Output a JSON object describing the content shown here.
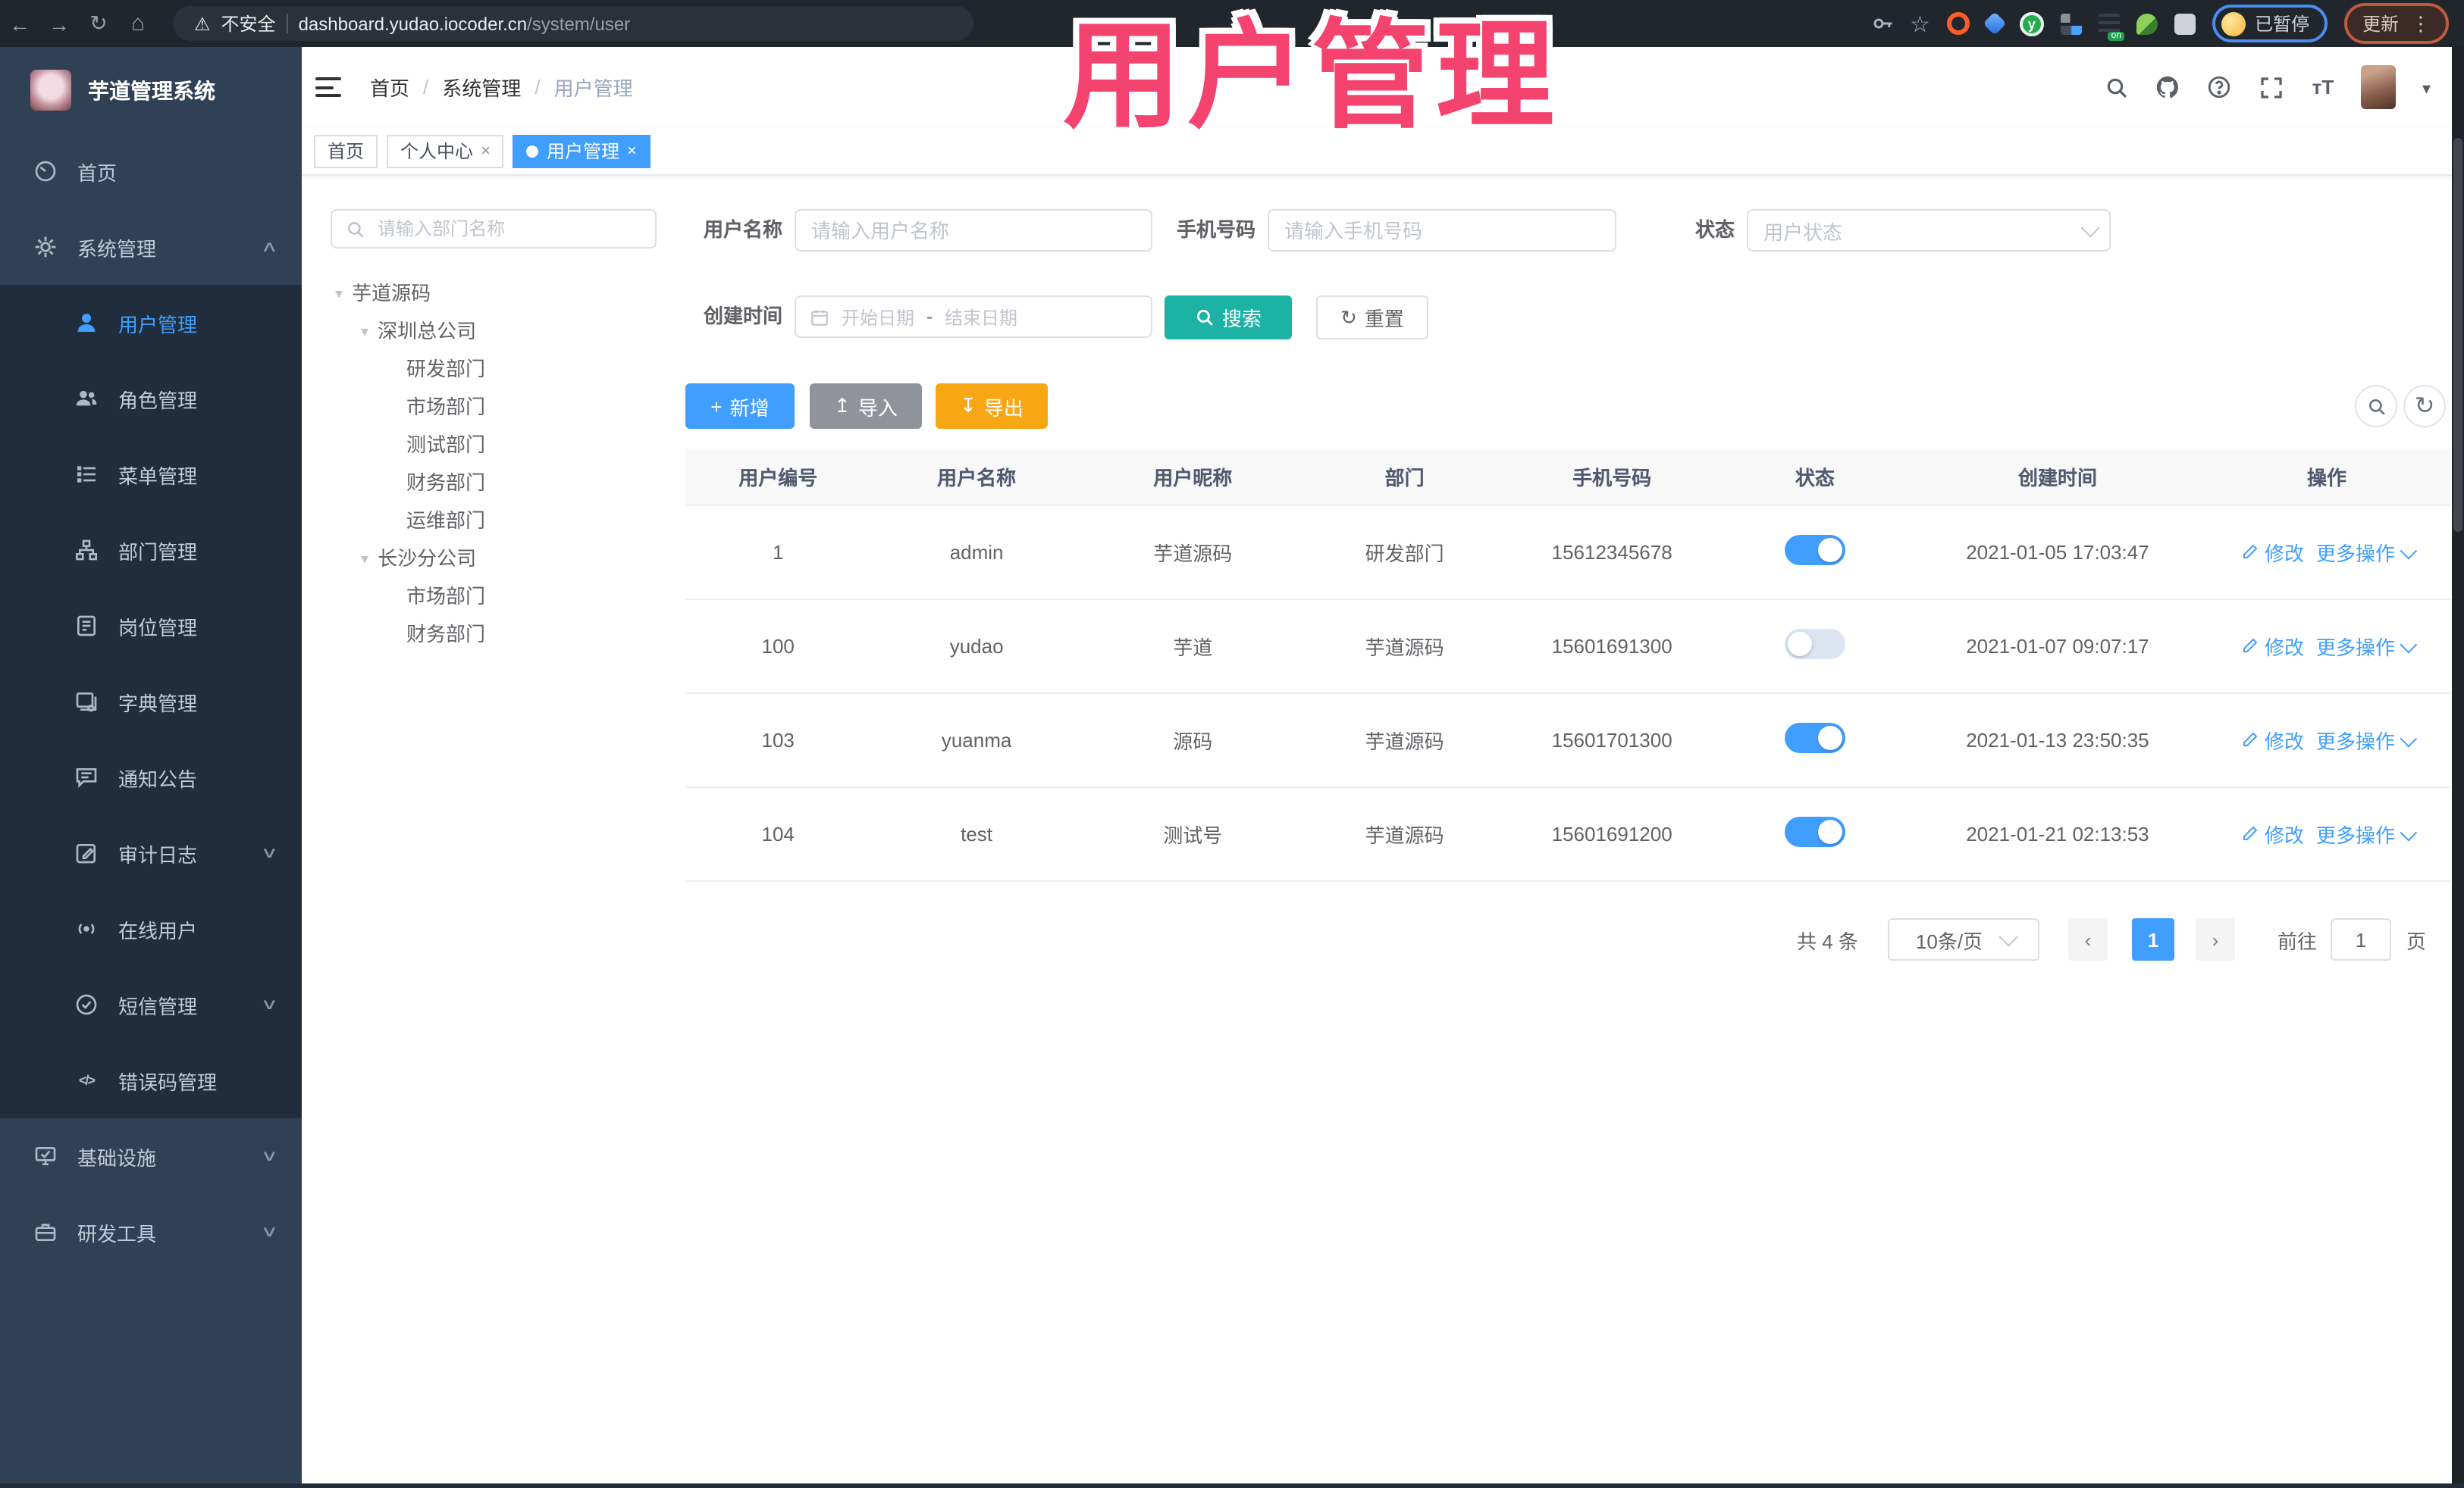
{
  "browser": {
    "security_label": "不安全",
    "url_host": "dashboard.yudao.iocoder.cn",
    "url_path": "/system/user",
    "paused_badge": "已暂停",
    "update_label": "更新"
  },
  "app": {
    "sidebar_title": "芋道管理系统",
    "overlay_title": "用户管理"
  },
  "sidebar": {
    "items": [
      {
        "label": "首页"
      },
      {
        "label": "系统管理"
      },
      {
        "label": "用户管理"
      },
      {
        "label": "角色管理"
      },
      {
        "label": "菜单管理"
      },
      {
        "label": "部门管理"
      },
      {
        "label": "岗位管理"
      },
      {
        "label": "字典管理"
      },
      {
        "label": "通知公告"
      },
      {
        "label": "审计日志"
      },
      {
        "label": "在线用户"
      },
      {
        "label": "短信管理"
      },
      {
        "label": "错误码管理"
      },
      {
        "label": "基础设施"
      },
      {
        "label": "研发工具"
      }
    ]
  },
  "breadcrumb": {
    "items": [
      "首页",
      "系统管理",
      "用户管理"
    ]
  },
  "tags": [
    {
      "label": "首页"
    },
    {
      "label": "个人中心"
    },
    {
      "label": "用户管理"
    }
  ],
  "dept": {
    "search_placeholder": "请输入部门名称",
    "tree": [
      {
        "label": "芋道源码",
        "level": 0,
        "caret": true
      },
      {
        "label": "深圳总公司",
        "level": 1,
        "caret": true
      },
      {
        "label": "研发部门",
        "level": 2,
        "caret": false
      },
      {
        "label": "市场部门",
        "level": 2,
        "caret": false
      },
      {
        "label": "测试部门",
        "level": 2,
        "caret": false
      },
      {
        "label": "财务部门",
        "level": 2,
        "caret": false
      },
      {
        "label": "运维部门",
        "level": 2,
        "caret": false
      },
      {
        "label": "长沙分公司",
        "level": 1,
        "caret": true
      },
      {
        "label": "市场部门",
        "level": 2,
        "caret": false
      },
      {
        "label": "财务部门",
        "level": 2,
        "caret": false
      }
    ]
  },
  "filters": {
    "username_label": "用户名称",
    "username_placeholder": "请输入用户名称",
    "mobile_label": "手机号码",
    "mobile_placeholder": "请输入手机号码",
    "status_label": "状态",
    "status_placeholder": "用户状态",
    "create_time_label": "创建时间",
    "start_placeholder": "开始日期",
    "range_separator": "-",
    "end_placeholder": "结束日期",
    "search_label": "搜索",
    "reset_label": "重置"
  },
  "toolbar": {
    "add_label": "新增",
    "import_label": "导入",
    "export_label": "导出"
  },
  "table": {
    "columns": [
      "用户编号",
      "用户名称",
      "用户昵称",
      "部门",
      "手机号码",
      "状态",
      "创建时间",
      "操作"
    ],
    "op": {
      "edit": "修改",
      "more": "更多操作"
    },
    "rows": [
      {
        "id": "1",
        "username": "admin",
        "nickname": "芋道源码",
        "dept": "研发部门",
        "mobile": "15612345678",
        "status": true,
        "created": "2021-01-05 17:03:47"
      },
      {
        "id": "100",
        "username": "yudao",
        "nickname": "芋道",
        "dept": "芋道源码",
        "mobile": "15601691300",
        "status": false,
        "created": "2021-01-07 09:07:17"
      },
      {
        "id": "103",
        "username": "yuanma",
        "nickname": "源码",
        "dept": "芋道源码",
        "mobile": "15601701300",
        "status": true,
        "created": "2021-01-13 23:50:35"
      },
      {
        "id": "104",
        "username": "test",
        "nickname": "测试号",
        "dept": "芋道源码",
        "mobile": "15601691200",
        "status": true,
        "created": "2021-01-21 02:13:53"
      }
    ]
  },
  "pagination": {
    "total_label": "共 4 条",
    "page_size": "10条/页",
    "current_page": "1",
    "goto_label": "前往",
    "goto_value": "1",
    "page_unit": "页"
  },
  "colors": {
    "accent": "#409EFF",
    "search_button": "#1CB2A4",
    "export_button": "#F7A614",
    "import_button": "#909399",
    "sidebar_bg": "#304156",
    "submenu_bg": "#1F2D3D",
    "overlay_pink": "#F4436E",
    "toggle_off": "#DBE4F0"
  }
}
